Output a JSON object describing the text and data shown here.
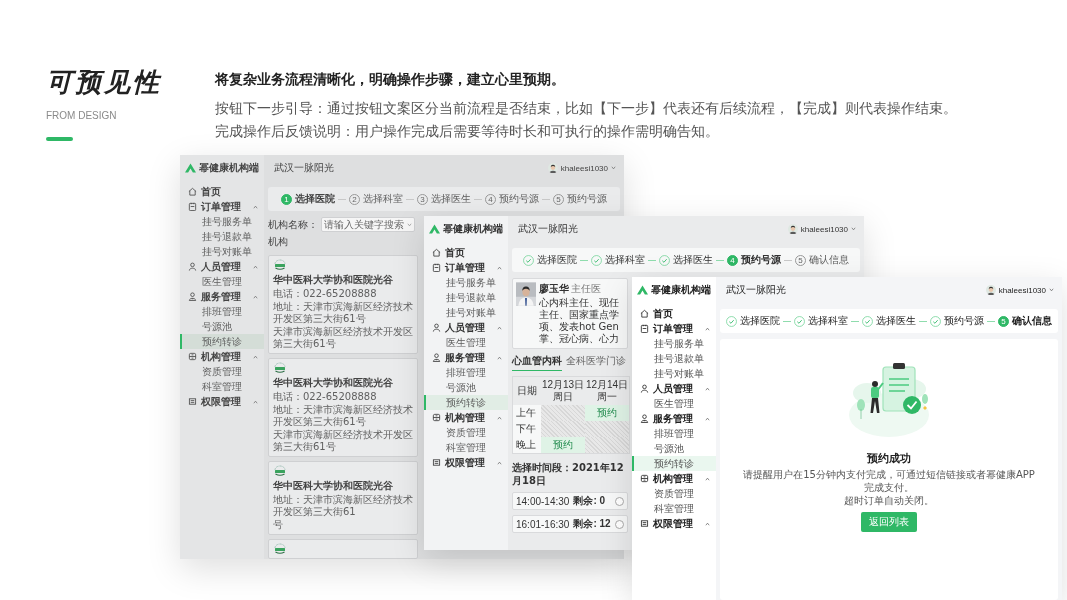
{
  "intro": {
    "title": "可预见性",
    "subtitle": "FROM DESIGN",
    "lead": "将复杂业务流程清晰化，明确操作步骤，建立心里预期。",
    "lines": [
      "按钮下一步引导：通过按钮文案区分当前流程是否结束，比如【下一步】代表还有后续流程，【完成】则代表操作结束。",
      "完成操作后反馈说明：用户操作完成后需要等待时长和可执行的操作需明确告知。"
    ]
  },
  "windows": [
    {
      "brand": "幂健康机构端",
      "location": "武汉一脉阳光",
      "user": "khaleesi1030",
      "sidebar": [
        {
          "label": "首页",
          "selected": false
        },
        {
          "label": "订单管理",
          "expanded": true,
          "children": [
            {
              "label": "挂号服务单",
              "selected": false
            },
            {
              "label": "挂号退款单",
              "selected": false
            },
            {
              "label": "挂号对账单",
              "selected": false
            }
          ]
        },
        {
          "label": "人员管理",
          "expanded": true,
          "children": [
            {
              "label": "医生管理",
              "selected": false
            }
          ]
        },
        {
          "label": "服务管理",
          "expanded": true,
          "children": [
            {
              "label": "排班管理",
              "selected": false
            },
            {
              "label": "号源池",
              "selected": false
            },
            {
              "label": "预约转诊",
              "selected": true
            }
          ]
        },
        {
          "label": "机构管理",
          "expanded": true,
          "children": [
            {
              "label": "资质管理",
              "selected": false
            },
            {
              "label": "科室管理",
              "selected": false
            }
          ]
        },
        {
          "label": "权限管理",
          "expanded": true
        }
      ],
      "stepper": [
        {
          "completed": false,
          "current": true,
          "number": "1",
          "label": "选择医院"
        },
        {
          "completed": false,
          "current": false,
          "number": "2",
          "label": "选择科室"
        },
        {
          "completed": false,
          "current": false,
          "number": "3",
          "label": "选择医生"
        },
        {
          "completed": false,
          "current": false,
          "number": "4",
          "label": "预约号源"
        },
        {
          "completed": false,
          "current": false,
          "number": "5",
          "label": "预约号源"
        }
      ],
      "content": {
        "kind": "hospitals",
        "filter": {
          "label": "机构名称：",
          "placeholder": "请输入关键字搜索",
          "next_label": "机构"
        },
        "cards": [
          {
            "kind": "full",
            "name": "华中医科大学协和医院光谷",
            "phone": "电话：022-65208888",
            "address": [
              "地址：天津市滨海新区经济技术开发区第三大街61号",
              "天津市滨海新区经济技术开发区第三大街61号"
            ]
          },
          {
            "kind": "full",
            "name": "华中医科大学协和医院光谷",
            "phone": "电话：022-65208888",
            "address": [
              "地址：天津市滨海新区经济技术开发区第三大街61号",
              "天津市滨海新区经济技术开发区第三大街61号"
            ]
          },
          {
            "kind": "full",
            "name": "华中医科大学协和医院光谷",
            "address": [
              "地址：天津市滨海新区经济技术开发区第三大街61",
              "号"
            ]
          },
          {
            "kind": "partial"
          }
        ]
      }
    },
    {
      "brand": "幂健康机构端",
      "location": "武汉一脉阳光",
      "user": "khaleesi1030",
      "sidebar": [
        {
          "label": "首页",
          "selected": false
        },
        {
          "label": "订单管理",
          "expanded": true,
          "children": [
            {
              "label": "挂号服务单",
              "selected": false
            },
            {
              "label": "挂号退款单",
              "selected": false
            },
            {
              "label": "挂号对账单",
              "selected": false
            }
          ]
        },
        {
          "label": "人员管理",
          "expanded": true,
          "children": [
            {
              "label": "医生管理",
              "selected": false
            }
          ]
        },
        {
          "label": "服务管理",
          "expanded": true,
          "children": [
            {
              "label": "排班管理",
              "selected": false
            },
            {
              "label": "号源池",
              "selected": false
            },
            {
              "label": "预约转诊",
              "selected": true
            }
          ]
        },
        {
          "label": "机构管理",
          "expanded": true,
          "children": [
            {
              "label": "资质管理",
              "selected": false
            },
            {
              "label": "科室管理",
              "selected": false
            }
          ]
        },
        {
          "label": "权限管理",
          "expanded": true
        }
      ],
      "stepper": [
        {
          "completed": true,
          "current": false,
          "label": "选择医院"
        },
        {
          "completed": true,
          "current": false,
          "label": "选择科室"
        },
        {
          "completed": true,
          "current": false,
          "label": "选择医生"
        },
        {
          "completed": false,
          "current": true,
          "number": "4",
          "label": "预约号源"
        },
        {
          "completed": false,
          "current": false,
          "number": "5",
          "label": "确认信息"
        }
      ],
      "content": {
        "kind": "schedule",
        "doctor": {
          "name": "廖玉华",
          "title": "主任医",
          "bio": [
            "心内科主任、现任",
            "主任、国家重点学",
            "项、发表hot Gen",
            "掌、冠心病、心力"
          ]
        },
        "tabs": [
          {
            "label": "心血管内科",
            "selected": true
          },
          {
            "label": "全科医学门诊",
            "selected": false
          }
        ],
        "table": {
          "columns": [
            {
              "lines": [
                "日期"
              ]
            },
            {
              "lines": [
                "12月13日",
                "周日"
              ]
            },
            {
              "lines": [
                "12月14日",
                "周一"
              ]
            }
          ],
          "rows": [
            {
              "cells": [
                {
                  "kind": "label",
                  "text": "上午"
                },
                {
                  "kind": "closed"
                },
                {
                  "kind": "open",
                  "text": "预约"
                }
              ]
            },
            {
              "cells": [
                {
                  "kind": "label",
                  "text": "下午"
                },
                {
                  "kind": "closed"
                },
                {
                  "kind": "closed"
                }
              ]
            },
            {
              "cells": [
                {
                  "kind": "label",
                  "text": "晚上"
                },
                {
                  "kind": "open",
                  "text": "预约"
                },
                {
                  "kind": "closed"
                }
              ]
            }
          ]
        },
        "slot_heading": "选择时间段：2021年12月18日",
        "slots": [
          {
            "time": "14:00-14:30",
            "remaining": "剩余: 0",
            "selected": false
          },
          {
            "time": "16:01-16:30",
            "remaining": "剩余: 12",
            "selected": false
          }
        ]
      }
    },
    {
      "brand": "幂健康机构端",
      "location": "武汉一脉阳光",
      "user": "khaleesi1030",
      "sidebar": [
        {
          "label": "首页",
          "selected": false
        },
        {
          "label": "订单管理",
          "expanded": true,
          "children": [
            {
              "label": "挂号服务单",
              "selected": false
            },
            {
              "label": "挂号退款单",
              "selected": false
            },
            {
              "label": "挂号对账单",
              "selected": false
            }
          ]
        },
        {
          "label": "人员管理",
          "expanded": true,
          "children": [
            {
              "label": "医生管理",
              "selected": false
            }
          ]
        },
        {
          "label": "服务管理",
          "expanded": true,
          "children": [
            {
              "label": "排班管理",
              "selected": false
            },
            {
              "label": "号源池",
              "selected": false
            },
            {
              "label": "预约转诊",
              "selected": true
            }
          ]
        },
        {
          "label": "机构管理",
          "expanded": true,
          "children": [
            {
              "label": "资质管理",
              "selected": false
            },
            {
              "label": "科室管理",
              "selected": false
            }
          ]
        },
        {
          "label": "权限管理",
          "expanded": true
        }
      ],
      "stepper": [
        {
          "completed": true,
          "current": false,
          "label": "选择医院"
        },
        {
          "completed": true,
          "current": false,
          "label": "选择科室"
        },
        {
          "completed": true,
          "current": false,
          "label": "选择医生"
        },
        {
          "completed": true,
          "current": false,
          "label": "预约号源"
        },
        {
          "completed": false,
          "current": true,
          "number": "5",
          "label": "确认信息"
        }
      ],
      "content": {
        "kind": "success",
        "title": "预约成功",
        "message": [
          "请提醒用户在15分钟内支付完成，可通过短信链接或者幂健康APP完成支付。",
          "超时订单自动关闭。"
        ],
        "button": "返回列表"
      }
    }
  ]
}
